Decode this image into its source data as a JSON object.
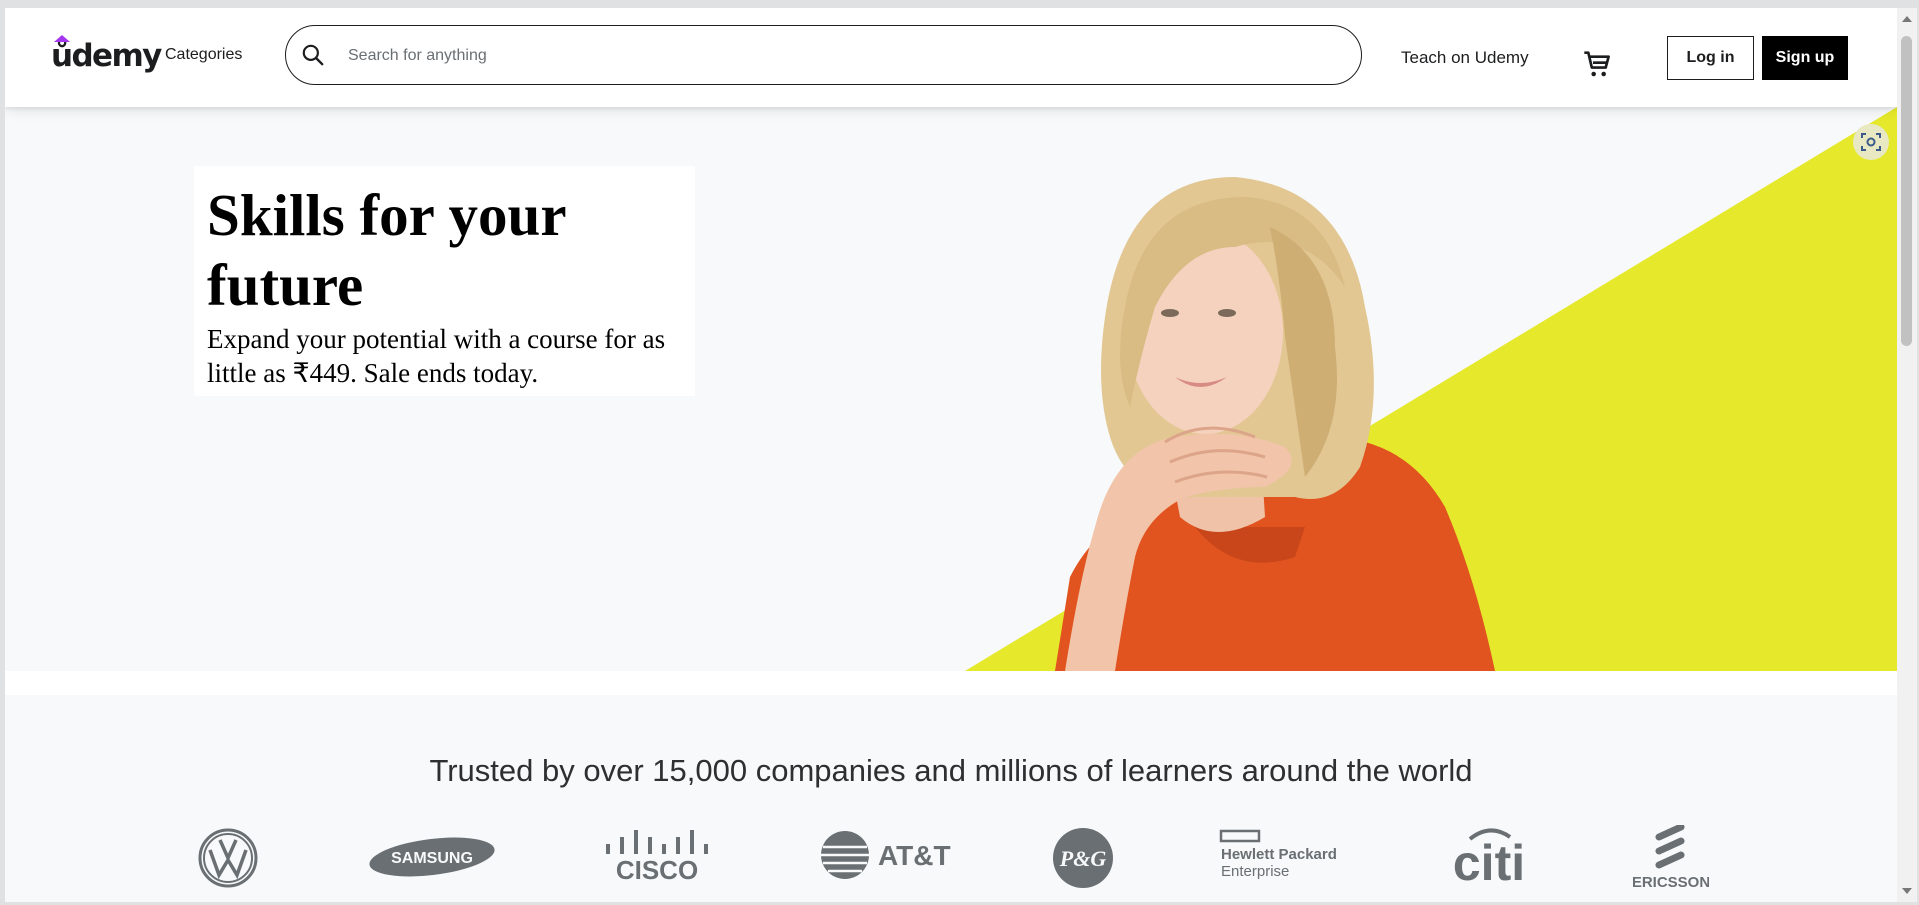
{
  "header": {
    "logo_text": "ůdemy",
    "categories_label": "Categories",
    "search_placeholder": "Search for anything",
    "teach_label": "Teach on Udemy",
    "login_label": "Log in",
    "signup_label": "Sign up"
  },
  "hero": {
    "title": "Skills for your future",
    "subtitle": "Expand your potential with a course for as little as ₹449. Sale ends today."
  },
  "trusted": {
    "text": "Trusted by over 15,000 companies and millions of learners around the world",
    "logos": [
      "volkswagen-logo",
      "samsung-logo",
      "cisco-logo",
      "att-logo",
      "pg-logo",
      "hpe-logo",
      "citi-logo",
      "ericsson-logo"
    ],
    "logo_texts": {
      "samsung": "SAMSUNG",
      "cisco": "CISCO",
      "att": "AT&T",
      "pg": "P&G",
      "hpe_line1": "Hewlett Packard",
      "hpe_line2": "Enterprise",
      "citi": "citi",
      "ericsson": "ERICSSON"
    }
  },
  "colors": {
    "accent_purple": "#a435f0",
    "hero_yellow": "#e6e82b",
    "shirt_orange": "#e1541f",
    "logo_gray": "#6a6f73"
  },
  "icons": [
    "search-icon",
    "cart-icon",
    "scan-icon"
  ]
}
